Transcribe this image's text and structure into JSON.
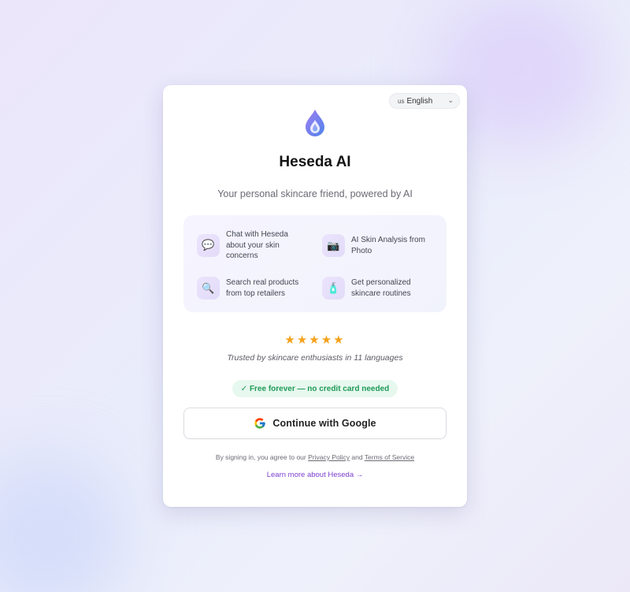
{
  "language": {
    "flag": "us",
    "selected": "English"
  },
  "app": {
    "name": "Heseda AI",
    "tagline": "Your personal skincare friend, powered by AI"
  },
  "features": [
    {
      "icon": "chat-bubble-icon",
      "text": "Chat with Heseda about your skin concerns"
    },
    {
      "icon": "camera-icon",
      "text": "AI Skin Analysis from Photo"
    },
    {
      "icon": "magnifier-icon",
      "text": "Search real products from top retailers"
    },
    {
      "icon": "lotion-bottle-icon",
      "text": "Get personalized skincare routines"
    }
  ],
  "rating": {
    "stars": "★★★★★",
    "text": "Trusted by skincare enthusiasts in 11 languages"
  },
  "badge": "✓ Free forever — no credit card needed",
  "google_button": "Continue with Google",
  "terms": {
    "prefix": "By signing in, you agree to our",
    "privacy": "Privacy Policy",
    "and": "and",
    "tos": "Terms of Service"
  },
  "learn_more": "Learn more about Heseda →",
  "colors": {
    "accent": "#7a3fd0",
    "star": "#f4a21b",
    "badge_bg": "#e7f8ef",
    "badge_text": "#1f9a57"
  }
}
